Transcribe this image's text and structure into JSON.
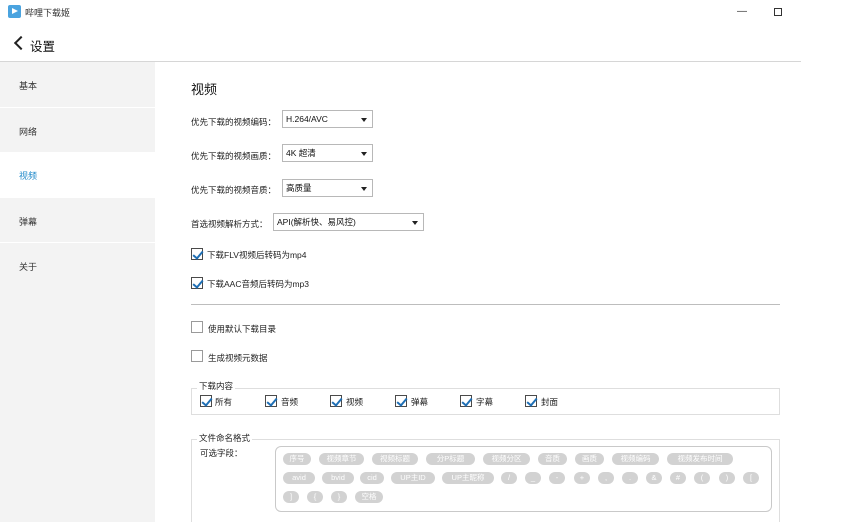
{
  "app": {
    "title": "哔哩下载姬",
    "minimize": "—"
  },
  "header": {
    "title": "设置"
  },
  "sidebar": {
    "items": [
      {
        "label": "基本"
      },
      {
        "label": "网络"
      },
      {
        "label": "视频",
        "active": true
      },
      {
        "label": "弹幕"
      },
      {
        "label": "关于"
      }
    ]
  },
  "main": {
    "section_title": "视频",
    "codec": {
      "label": "优先下载的视频编码：",
      "value": "H.264/AVC"
    },
    "quality": {
      "label": "优先下载的视频画质：",
      "value": "4K 超清"
    },
    "audio": {
      "label": "优先下载的视频音质：",
      "value": "高质量"
    },
    "parse": {
      "label": "首选视频解析方式：",
      "value": "API(解析快、易风控)"
    },
    "flv_to_mp4": {
      "label": "下载FLV视频后转码为mp4",
      "checked": true
    },
    "aac_to_mp3": {
      "label": "下载AAC音频后转码为mp3",
      "checked": true
    },
    "default_dir": {
      "label": "使用默认下载目录",
      "checked": false
    },
    "metadata": {
      "label": "生成视频元数据",
      "checked": false
    },
    "download_content": {
      "title": "下载内容",
      "options": [
        {
          "label": "所有",
          "checked": true
        },
        {
          "label": "音频",
          "checked": true
        },
        {
          "label": "视频",
          "checked": true
        },
        {
          "label": "弹幕",
          "checked": true
        },
        {
          "label": "字幕",
          "checked": true
        },
        {
          "label": "封面",
          "checked": true
        }
      ]
    },
    "file_naming": {
      "title": "文件命名格式",
      "optional_label": "可选字段：",
      "fields_row1": [
        "序号",
        "视频章节",
        "视频标题",
        "分P标题",
        "视频分区",
        "音质",
        "画质",
        "视频编码",
        "视频发布时间"
      ],
      "fields_row2": [
        "avid",
        "bvid",
        "cid",
        "UP主ID",
        "UP主昵称",
        "/",
        "_",
        "-",
        "+",
        ",",
        ".",
        "&",
        "#",
        "(",
        ")",
        "["
      ],
      "fields_row3": [
        "]",
        "{",
        "}",
        "空格"
      ]
    }
  },
  "colors": {
    "accent": "#1e88c9",
    "tag_bg": "#d2d2d2",
    "sidebar_bg": "#f3f3f3"
  }
}
